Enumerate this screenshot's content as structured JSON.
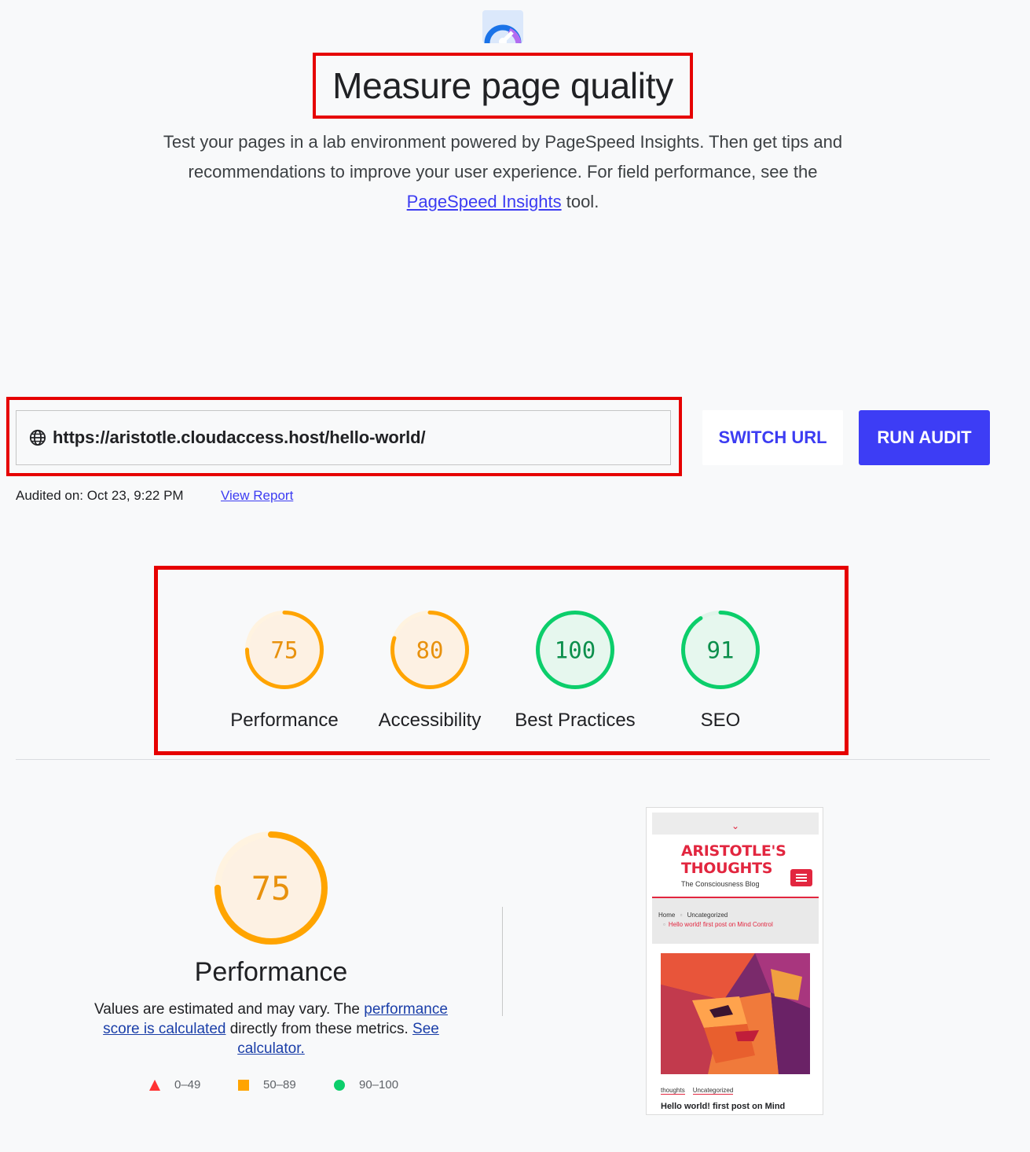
{
  "header": {
    "title": "Measure page quality",
    "intro_before": "Test your pages in a lab environment powered by PageSpeed Insights. Then get tips and recommendations to improve your user experience. For field performance, see the ",
    "intro_link": "PageSpeed Insights",
    "intro_after": " tool."
  },
  "url_bar": {
    "url": "https://aristotle.cloudaccess.host/hello-world/",
    "switch_label": "SWITCH URL",
    "run_label": "RUN AUDIT",
    "audited_text": "Audited on: Oct 23, 9:22 PM",
    "view_report": "View Report"
  },
  "scores": [
    {
      "label": "Performance",
      "value": "75",
      "score": 0.75,
      "color": "#ffa400",
      "track": "#fff3e0",
      "fill": "#fdf1e3",
      "text_color": "#e8910d"
    },
    {
      "label": "Accessibility",
      "value": "80",
      "score": 0.8,
      "color": "#ffa400",
      "track": "#fff3e0",
      "fill": "#fdf1e3",
      "text_color": "#e8910d"
    },
    {
      "label": "Best Practices",
      "value": "100",
      "score": 1.0,
      "color": "#0cce6b",
      "track": "#e0f5ea",
      "fill": "#e6f7ee",
      "text_color": "#0c8f4c"
    },
    {
      "label": "SEO",
      "value": "91",
      "score": 0.91,
      "color": "#0cce6b",
      "track": "#e0f5ea",
      "fill": "#e6f7ee",
      "text_color": "#0c8f4c"
    }
  ],
  "performance": {
    "value": "75",
    "score": 0.75,
    "title": "Performance",
    "desc_1": "Values are estimated and may vary. The ",
    "link_1": "performance score is calculated",
    "desc_2": " directly from these metrics. ",
    "link_2": "See calculator.",
    "legend": [
      {
        "range": "0–49",
        "shape": "triangle",
        "color": "#ff3333"
      },
      {
        "range": "50–89",
        "shape": "square",
        "color": "#ffa400"
      },
      {
        "range": "90–100",
        "shape": "circle",
        "color": "#0cce6b"
      }
    ]
  },
  "thumbnail": {
    "site_title": "ARISTOTLE'S THOUGHTS",
    "site_subtitle": "The Consciousness Blog",
    "crumb_home": "Home",
    "crumb_cat": "Uncategorized",
    "crumb_post": "Hello world! first post on Mind Control",
    "tag_1": "thoughts",
    "tag_2": "Uncategorized",
    "post_title": "Hello world! first post on Mind"
  },
  "colors": {
    "accent": "#3d3df5",
    "highlight": "#e60000",
    "brand_red": "#e2263f"
  }
}
